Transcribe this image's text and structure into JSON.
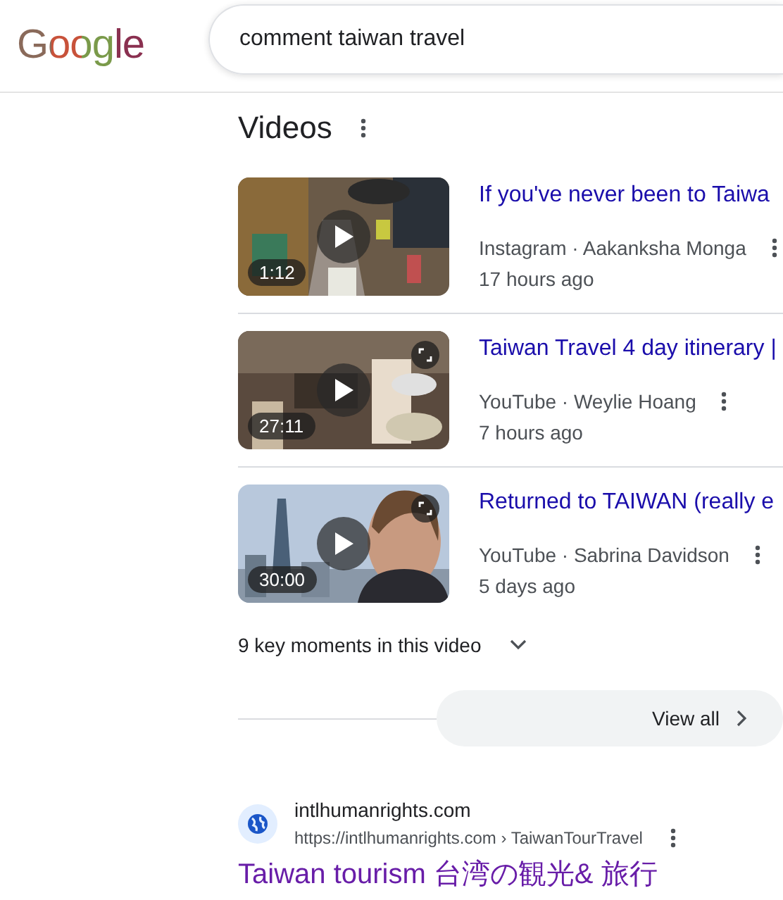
{
  "header": {
    "logo": "Google",
    "search": {
      "value": "comment taiwan travel"
    }
  },
  "videos": {
    "heading": "Videos",
    "items": [
      {
        "title": "If you've never been to Taiwa",
        "source": "Instagram · Aakanksha Monga",
        "age": "17 hours ago",
        "duration": "1:12",
        "expand_button": false
      },
      {
        "title": "Taiwan Travel 4 day itinerary |",
        "source": "YouTube · Weylie Hoang",
        "age": "7 hours ago",
        "duration": "27:11",
        "expand_button": true
      },
      {
        "title": "Returned to TAIWAN (really e",
        "source": "YouTube · Sabrina Davidson",
        "age": "5 days ago",
        "duration": "30:00",
        "expand_button": true
      }
    ],
    "key_moments": "9 key moments in this video",
    "view_all": "View all"
  },
  "result": {
    "site": "intlhumanrights.com",
    "url": "https://intlhumanrights.com › TaiwanTourTravel",
    "title": "Taiwan tourism 台湾の観光& 旅行",
    "visited": true
  }
}
